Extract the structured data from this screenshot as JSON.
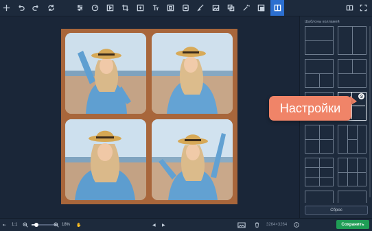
{
  "toolbar": {
    "icons": [
      "add-icon",
      "undo-icon",
      "redo-icon",
      "reset-icon",
      "adjust-icon",
      "filter-icon",
      "enhance-icon",
      "crop-icon",
      "transform-icon",
      "text-icon",
      "frame-icon",
      "retouch-icon",
      "image-icon",
      "replace-background-icon",
      "object-remove-icon",
      "collage-icon",
      "layout-icon"
    ]
  },
  "right_panel": {
    "title": "Шаблоны коллажей",
    "reset_label": "Сброс"
  },
  "callout": {
    "text": "Настройки"
  },
  "bottom": {
    "ratio_label": "1:1",
    "zoom_label": "18%",
    "dimensions": "3264×3264",
    "save_label": "Сохранить",
    "zoom_fraction": 0.18
  },
  "colors": {
    "canvas_border": "#a8663b",
    "accent": "#2c6fd0",
    "save": "#1f9d55",
    "callout": "#f08468"
  }
}
